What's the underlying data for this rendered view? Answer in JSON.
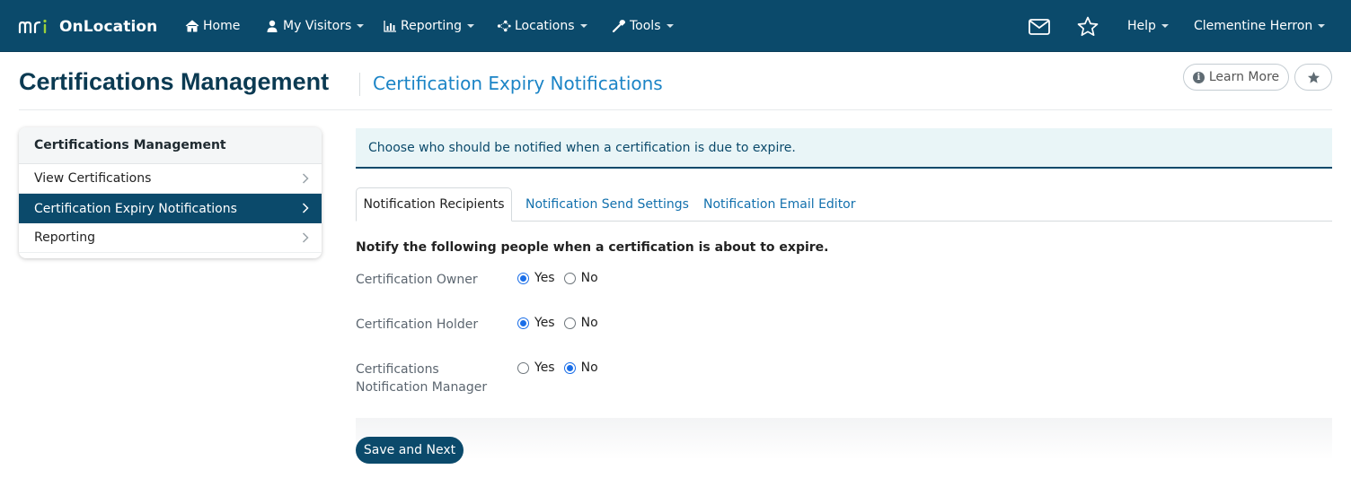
{
  "brand": {
    "name": "OnLocation",
    "logo": "mri-logo"
  },
  "nav": {
    "items": [
      {
        "label": "Home",
        "icon": "home-icon"
      },
      {
        "label": "My Visitors",
        "icon": "user-icon"
      },
      {
        "label": "Reporting",
        "icon": "bar-chart-icon"
      },
      {
        "label": "Locations",
        "icon": "network-icon"
      },
      {
        "label": "Tools",
        "icon": "wrench-icon"
      }
    ],
    "help_label": "Help",
    "user_label": "Clementine Herron",
    "mail_icon": "envelope-icon",
    "favorites_icon": "star-icon"
  },
  "header": {
    "title": "Certifications Management",
    "subtitle": "Certification Expiry Notifications",
    "learn_more_label": "Learn More"
  },
  "sidebar": {
    "heading": "Certifications Management",
    "items": [
      {
        "label": "View Certifications",
        "active": false
      },
      {
        "label": "Certification Expiry Notifications",
        "active": true
      },
      {
        "label": "Reporting",
        "active": false
      }
    ]
  },
  "banner": {
    "text": "Choose who should be notified when a certification is due to expire."
  },
  "tabs": [
    {
      "label": "Notification Recipients",
      "active": true
    },
    {
      "label": "Notification Send Settings",
      "active": false
    },
    {
      "label": "Notification Email Editor",
      "active": false
    }
  ],
  "form": {
    "intro": "Notify the following people when a certification is about to expire.",
    "yes_label": "Yes",
    "no_label": "No",
    "fields": [
      {
        "label": "Certification Owner",
        "value": "Yes"
      },
      {
        "label": "Certification Holder",
        "value": "Yes"
      },
      {
        "label_line1": "Certifications",
        "label_line2": "Notification Manager",
        "value": "No"
      }
    ],
    "save_label": "Save and Next"
  },
  "colors": {
    "navbar": "#0b4a6b",
    "accent_link": "#1b84c6",
    "radio_selected": "#1a6ee8",
    "banner_bg": "#e9f5f7"
  }
}
